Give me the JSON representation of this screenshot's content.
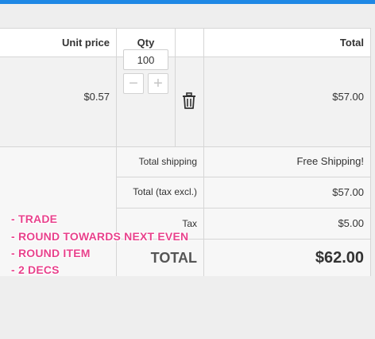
{
  "table": {
    "headers": {
      "unit_price": "Unit price",
      "qty": "Qty",
      "total": "Total"
    },
    "item": {
      "unit_price": "$0.57",
      "qty_value": "100",
      "minus_symbol": "−",
      "plus_symbol": "+",
      "total": "$57.00",
      "delete_icon": "trash-icon"
    }
  },
  "summary": {
    "shipping_label": "Total shipping",
    "shipping_value": "Free Shipping!",
    "subtotal_label": "Total (tax excl.)",
    "subtotal_value": "$57.00",
    "tax_label": "Tax",
    "tax_value": "$5.00",
    "total_label": "TOTAL",
    "total_value": "$62.00"
  },
  "notes": [
    "- TRADE",
    "- ROUND TOWARDS NEXT EVEN",
    "- ROUND ITEM",
    "- 2 DECS"
  ],
  "colors": {
    "accent_bar": "#1e88e5",
    "note_text": "#e8428c"
  }
}
